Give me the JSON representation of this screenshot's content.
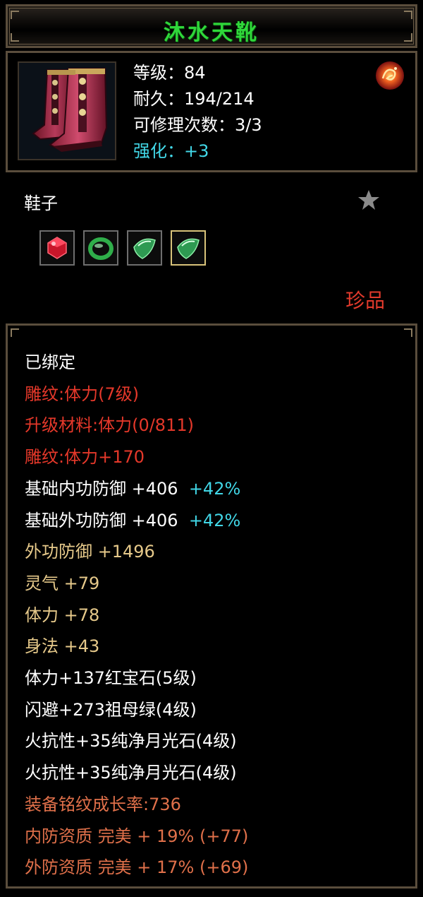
{
  "item": {
    "name": "沐水天靴",
    "level": "等级：84",
    "durability": "耐久：194/214",
    "repairs": "可修理次数：3/3",
    "enhance": "强化：+3",
    "category": "鞋子",
    "rarity": "珍品"
  },
  "gems": [
    {
      "name": "ruby-gem-icon",
      "color": "#c8162a"
    },
    {
      "name": "emerald-ring-gem-icon",
      "color": "#2fae4a"
    },
    {
      "name": "moonstone-gem-icon",
      "color": "#48c86a"
    },
    {
      "name": "moonstone-gem-icon",
      "color": "#48c86a"
    }
  ],
  "attributes": {
    "bound": "已绑定",
    "engrave": "雕纹:体力(7级)",
    "upgrade_material": "升级材料:体力(0/811)",
    "engrave_bonus": "雕纹:体力+170",
    "base_inner_def": "基础内功防御 +406",
    "base_inner_def_pct": "+42%",
    "base_outer_def": "基础外功防御 +406",
    "base_outer_def_pct": "+42%",
    "outer_def": "外功防御 +1496",
    "spirit": "灵气 +79",
    "stamina": "体力 +78",
    "agility": "身法 +43",
    "gem1": "体力+137红宝石(5级)",
    "gem2": "闪避+273祖母绿(4级)",
    "gem3": "火抗性+35纯净月光石(4级)",
    "gem4": "火抗性+35纯净月光石(4级)",
    "growth": "装备铭纹成长率:736",
    "inner_quality": "内防资质 完美 + 19% (+77)",
    "outer_quality": "外防资质 完美 + 17% (+69)"
  },
  "colors": {
    "title": "#2fd73a",
    "cyan": "#41d6e6",
    "red": "#e5382a",
    "yellow": "#e6c98a",
    "orange": "#e0704a",
    "rarity": "#e23a2c",
    "frame": "#5a4d3c"
  }
}
